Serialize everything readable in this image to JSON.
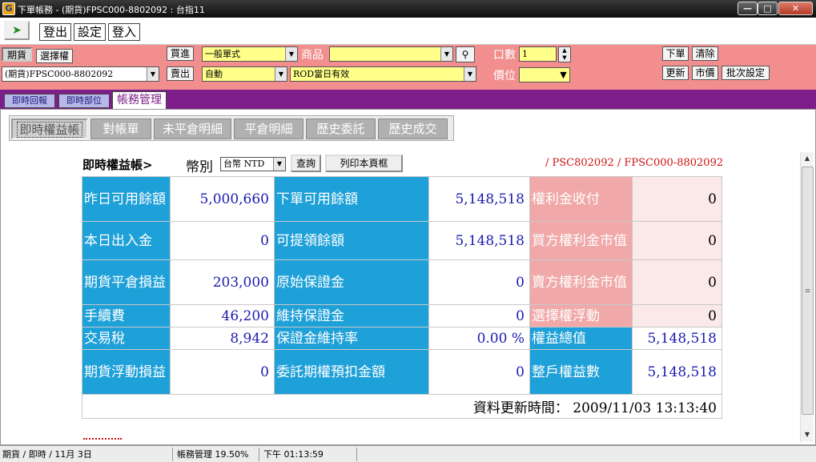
{
  "window": {
    "title": "下單帳務 - (期貨)FPSC000-8802092 : 台指11",
    "app_icon": "G"
  },
  "menu": {
    "items": [
      "登出",
      "設定",
      "登入"
    ]
  },
  "order": {
    "market_tabs": [
      "期貨",
      "選擇權"
    ],
    "account": "(期貨)FPSC000-8802092",
    "buy_label": "買進",
    "sell_label": "賣出",
    "order_type": "一般單式",
    "mode": "自動",
    "product_label": "商品",
    "product_value": "",
    "validity": "ROD當日有效",
    "qty_label": "口數",
    "qty_value": "1",
    "price_label": "價位",
    "price_value": "",
    "btn_place": "下單",
    "btn_clear": "清除",
    "btn_refresh": "更新",
    "btn_market": "市價",
    "btn_batch": "批次設定"
  },
  "main_tabs": [
    "即時回報",
    "即時部位",
    "帳務管理"
  ],
  "sub_tabs": [
    "即時權益帳",
    "對帳單",
    "未平倉明細",
    "平倉明細",
    "歷史委託",
    "歷史成交"
  ],
  "equity": {
    "title": "即時權益帳>",
    "currency_label": "幣別",
    "currency_value": "台幣 NTD",
    "query_button": "查詢",
    "print_button": "列印本頁框",
    "account_path": "/ PSC802092 / FPSC000-8802092",
    "rows": [
      {
        "l1": "昨日可用餘額",
        "v1": "5,000,660",
        "l2": "下單可用餘額",
        "v2": "5,148,518",
        "l3": "權利金收付",
        "v3": "0"
      },
      {
        "l1": "本日出入金",
        "v1": "0",
        "l2": "可提領餘額",
        "v2": "5,148,518",
        "l3": "買方權利金市值",
        "v3": "0"
      },
      {
        "l1": "期貨平倉損益",
        "v1": "203,000",
        "l2": "原始保證金",
        "v2": "0",
        "l3": "賣方權利金市值",
        "v3": "0"
      },
      {
        "l1": "手續費",
        "v1": "46,200",
        "l2": "維持保證金",
        "v2": "0",
        "l3": "選擇權浮動",
        "v3": "0"
      },
      {
        "l1": "交易稅",
        "v1": "8,942",
        "l2": "保證金維持率",
        "v2": "0.00 %",
        "l3": "權益總值",
        "v3": "5,148,518"
      },
      {
        "l1": "期貨浮動損益",
        "v1": "0",
        "l2": "委託期權預扣金額",
        "v2": "0",
        "l3": "整戶權益數",
        "v3": "5,148,518"
      }
    ],
    "update_label": "資料更新時間：",
    "update_time": "2009/11/03 13:13:40"
  },
  "status": {
    "left": "期貨 / 即時 / 11月 3日",
    "middle": "帳務管理 19.50%",
    "time": "下午 01:13:59"
  },
  "colors": {
    "order_panel": "#f28e8e",
    "tab_bar": "#7d1e8a",
    "label_blue": "#1ea0d8",
    "label_pink": "#f0a8a8"
  }
}
